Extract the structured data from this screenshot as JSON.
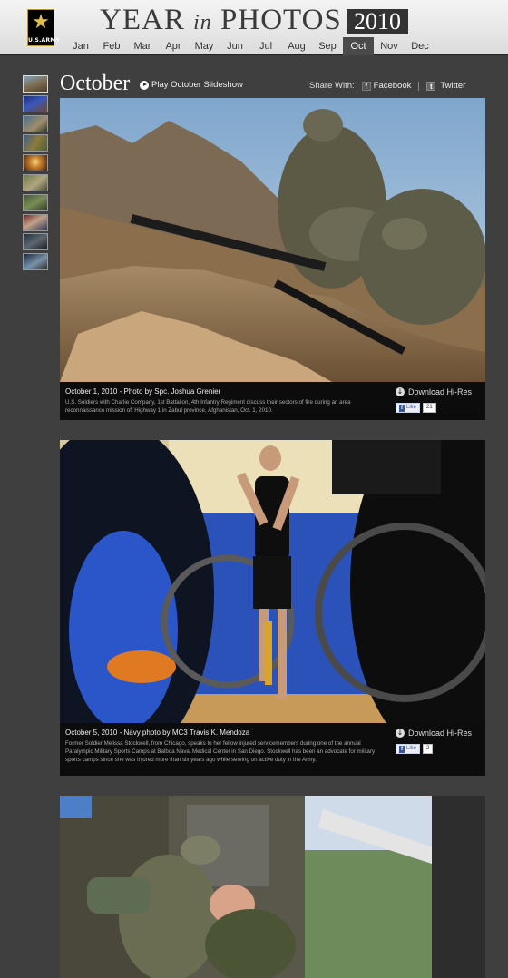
{
  "header": {
    "logo_text": "U.S.ARMY",
    "title_year": "YEAR",
    "title_in": "in",
    "title_photos": "PHOTOS",
    "year": "2010",
    "months": [
      "Jan",
      "Feb",
      "Mar",
      "Apr",
      "May",
      "Jun",
      "Jul",
      "Aug",
      "Sep",
      "Oct",
      "Nov",
      "Dec"
    ],
    "active_month": "Oct"
  },
  "section": {
    "title": "October",
    "slideshow_label": "Play October Slideshow",
    "share_label": "Share With:",
    "facebook_label": "Facebook",
    "twitter_label": "Twitter"
  },
  "photos": [
    {
      "title": "October 1, 2010 - Photo by Spc. Joshua Grenier",
      "description": "U.S. Soldiers with Charlie Company, 1st Battalion, 4th Infantry Regiment discuss their sectors of fire during an area reconnaissance mission off Highway 1 in Zabul province, Afghanistan, Oct. 1, 2010.",
      "download_label": "Download Hi-Res",
      "like_label": "Like",
      "like_count": "21"
    },
    {
      "title": "October 5, 2010 - Navy photo by MC3 Travis K. Mendoza",
      "description": "Former Soldier Melissa Stockwell, from Chicago, speaks to her fellow injured servicemembers during one of the annual Paralympic Military Sports Camps at Balboa Naval Medical Center in San Diego. Stockwell has been an advocate for military sports camps since she was injured more than six years ago while serving on active duty in the Army.",
      "download_label": "Download Hi-Res",
      "like_label": "Like",
      "like_count": "2"
    }
  ],
  "colors": {
    "page_bg": "#3f3f3f",
    "header_bg": "#e6e6e6",
    "active_month_bg": "#4a4a4a",
    "caption_bg": "#0c0c0c",
    "army_gold": "#e2c043"
  }
}
